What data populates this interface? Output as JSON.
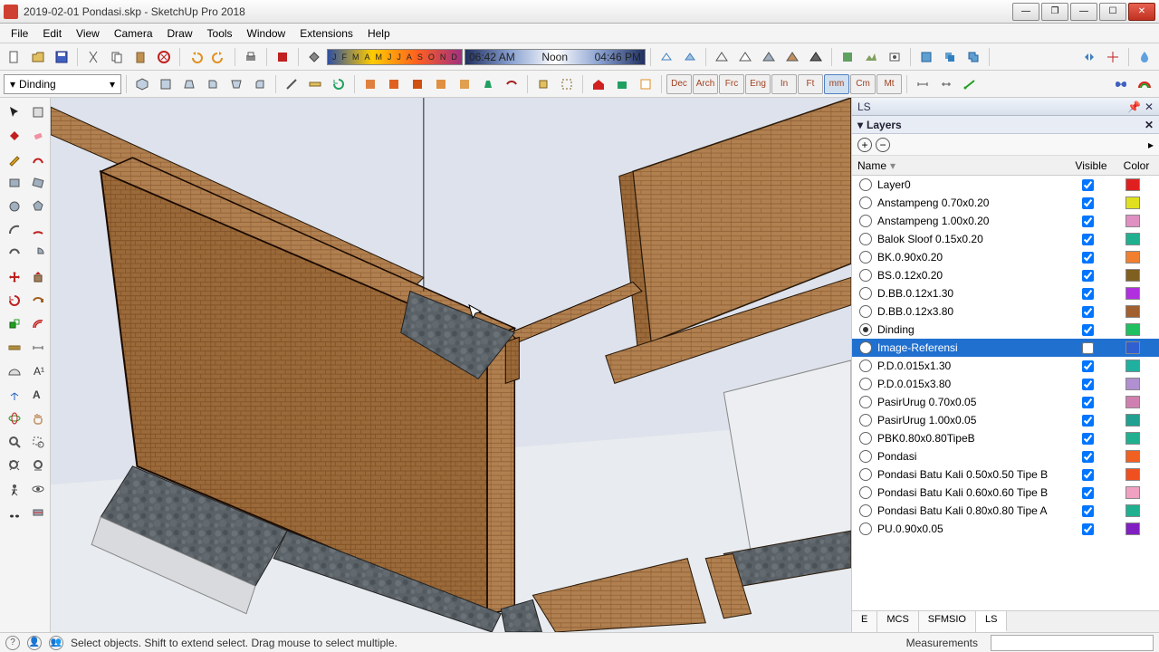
{
  "window": {
    "title": "2019-02-01 Pondasi.skp - SketchUp Pro 2018"
  },
  "menus": [
    "File",
    "Edit",
    "View",
    "Camera",
    "Draw",
    "Tools",
    "Window",
    "Extensions",
    "Help"
  ],
  "shadow": {
    "months": [
      "J",
      "F",
      "M",
      "A",
      "M",
      "J",
      "J",
      "A",
      "S",
      "O",
      "N",
      "D"
    ],
    "time_start": "06:42 AM",
    "time_noon": "Noon",
    "time_end": "04:46 PM"
  },
  "layer_combo": {
    "value": "Dinding"
  },
  "units": [
    "Dec",
    "Arch",
    "Frc",
    "Eng",
    "In",
    "Ft",
    "mm",
    "Cm",
    "Mt"
  ],
  "active_unit": "mm",
  "panel": {
    "tray_title": "LS",
    "section": "Layers",
    "columns": {
      "name": "Name",
      "visible": "Visible",
      "color": "Color"
    },
    "tabs": [
      "E",
      "MCS",
      "SFMSIO",
      "LS"
    ],
    "active_tab": "LS"
  },
  "layers": [
    {
      "name": "Layer0",
      "visible": true,
      "color": "#e02020",
      "active": false
    },
    {
      "name": "Anstampeng 0.70x0.20",
      "visible": true,
      "color": "#e0e020",
      "active": false
    },
    {
      "name": "Anstampeng 1.00x0.20",
      "visible": true,
      "color": "#e090c0",
      "active": false
    },
    {
      "name": "Balok Sloof 0.15x0.20",
      "visible": true,
      "color": "#20b090",
      "active": false
    },
    {
      "name": "BK.0.90x0.20",
      "visible": true,
      "color": "#f08030",
      "active": false
    },
    {
      "name": "BS.0.12x0.20",
      "visible": true,
      "color": "#806020",
      "active": false
    },
    {
      "name": "D.BB.0.12x1.30",
      "visible": true,
      "color": "#b030e0",
      "active": false
    },
    {
      "name": "D.BB.0.12x3.80",
      "visible": true,
      "color": "#a06030",
      "active": false
    },
    {
      "name": "Dinding",
      "visible": true,
      "color": "#20c060",
      "active": true
    },
    {
      "name": "Image-Referensi",
      "visible": false,
      "color": "#3060d0",
      "active": false,
      "selected": true
    },
    {
      "name": "P.D.0.015x1.30",
      "visible": true,
      "color": "#20b0a0",
      "active": false
    },
    {
      "name": "P.D.0.015x3.80",
      "visible": true,
      "color": "#b090d0",
      "active": false
    },
    {
      "name": "PasirUrug 0.70x0.05",
      "visible": true,
      "color": "#d080b0",
      "active": false
    },
    {
      "name": "PasirUrug 1.00x0.05",
      "visible": true,
      "color": "#20a090",
      "active": false
    },
    {
      "name": "PBK0.80x0.80TipeB",
      "visible": true,
      "color": "#20b090",
      "active": false
    },
    {
      "name": "Pondasi",
      "visible": true,
      "color": "#f06020",
      "active": false
    },
    {
      "name": "Pondasi Batu Kali 0.50x0.50 Tipe B",
      "visible": true,
      "color": "#f05020",
      "active": false
    },
    {
      "name": "Pondasi Batu Kali 0.60x0.60 Tipe B",
      "visible": true,
      "color": "#f0a0c0",
      "active": false
    },
    {
      "name": "Pondasi Batu Kali 0.80x0.80 Tipe A",
      "visible": true,
      "color": "#20b090",
      "active": false
    },
    {
      "name": "PU.0.90x0.05",
      "visible": true,
      "color": "#8020c0",
      "active": false
    }
  ],
  "status": {
    "hint": "Select objects. Shift to extend select. Drag mouse to select multiple.",
    "measurements_label": "Measurements"
  }
}
